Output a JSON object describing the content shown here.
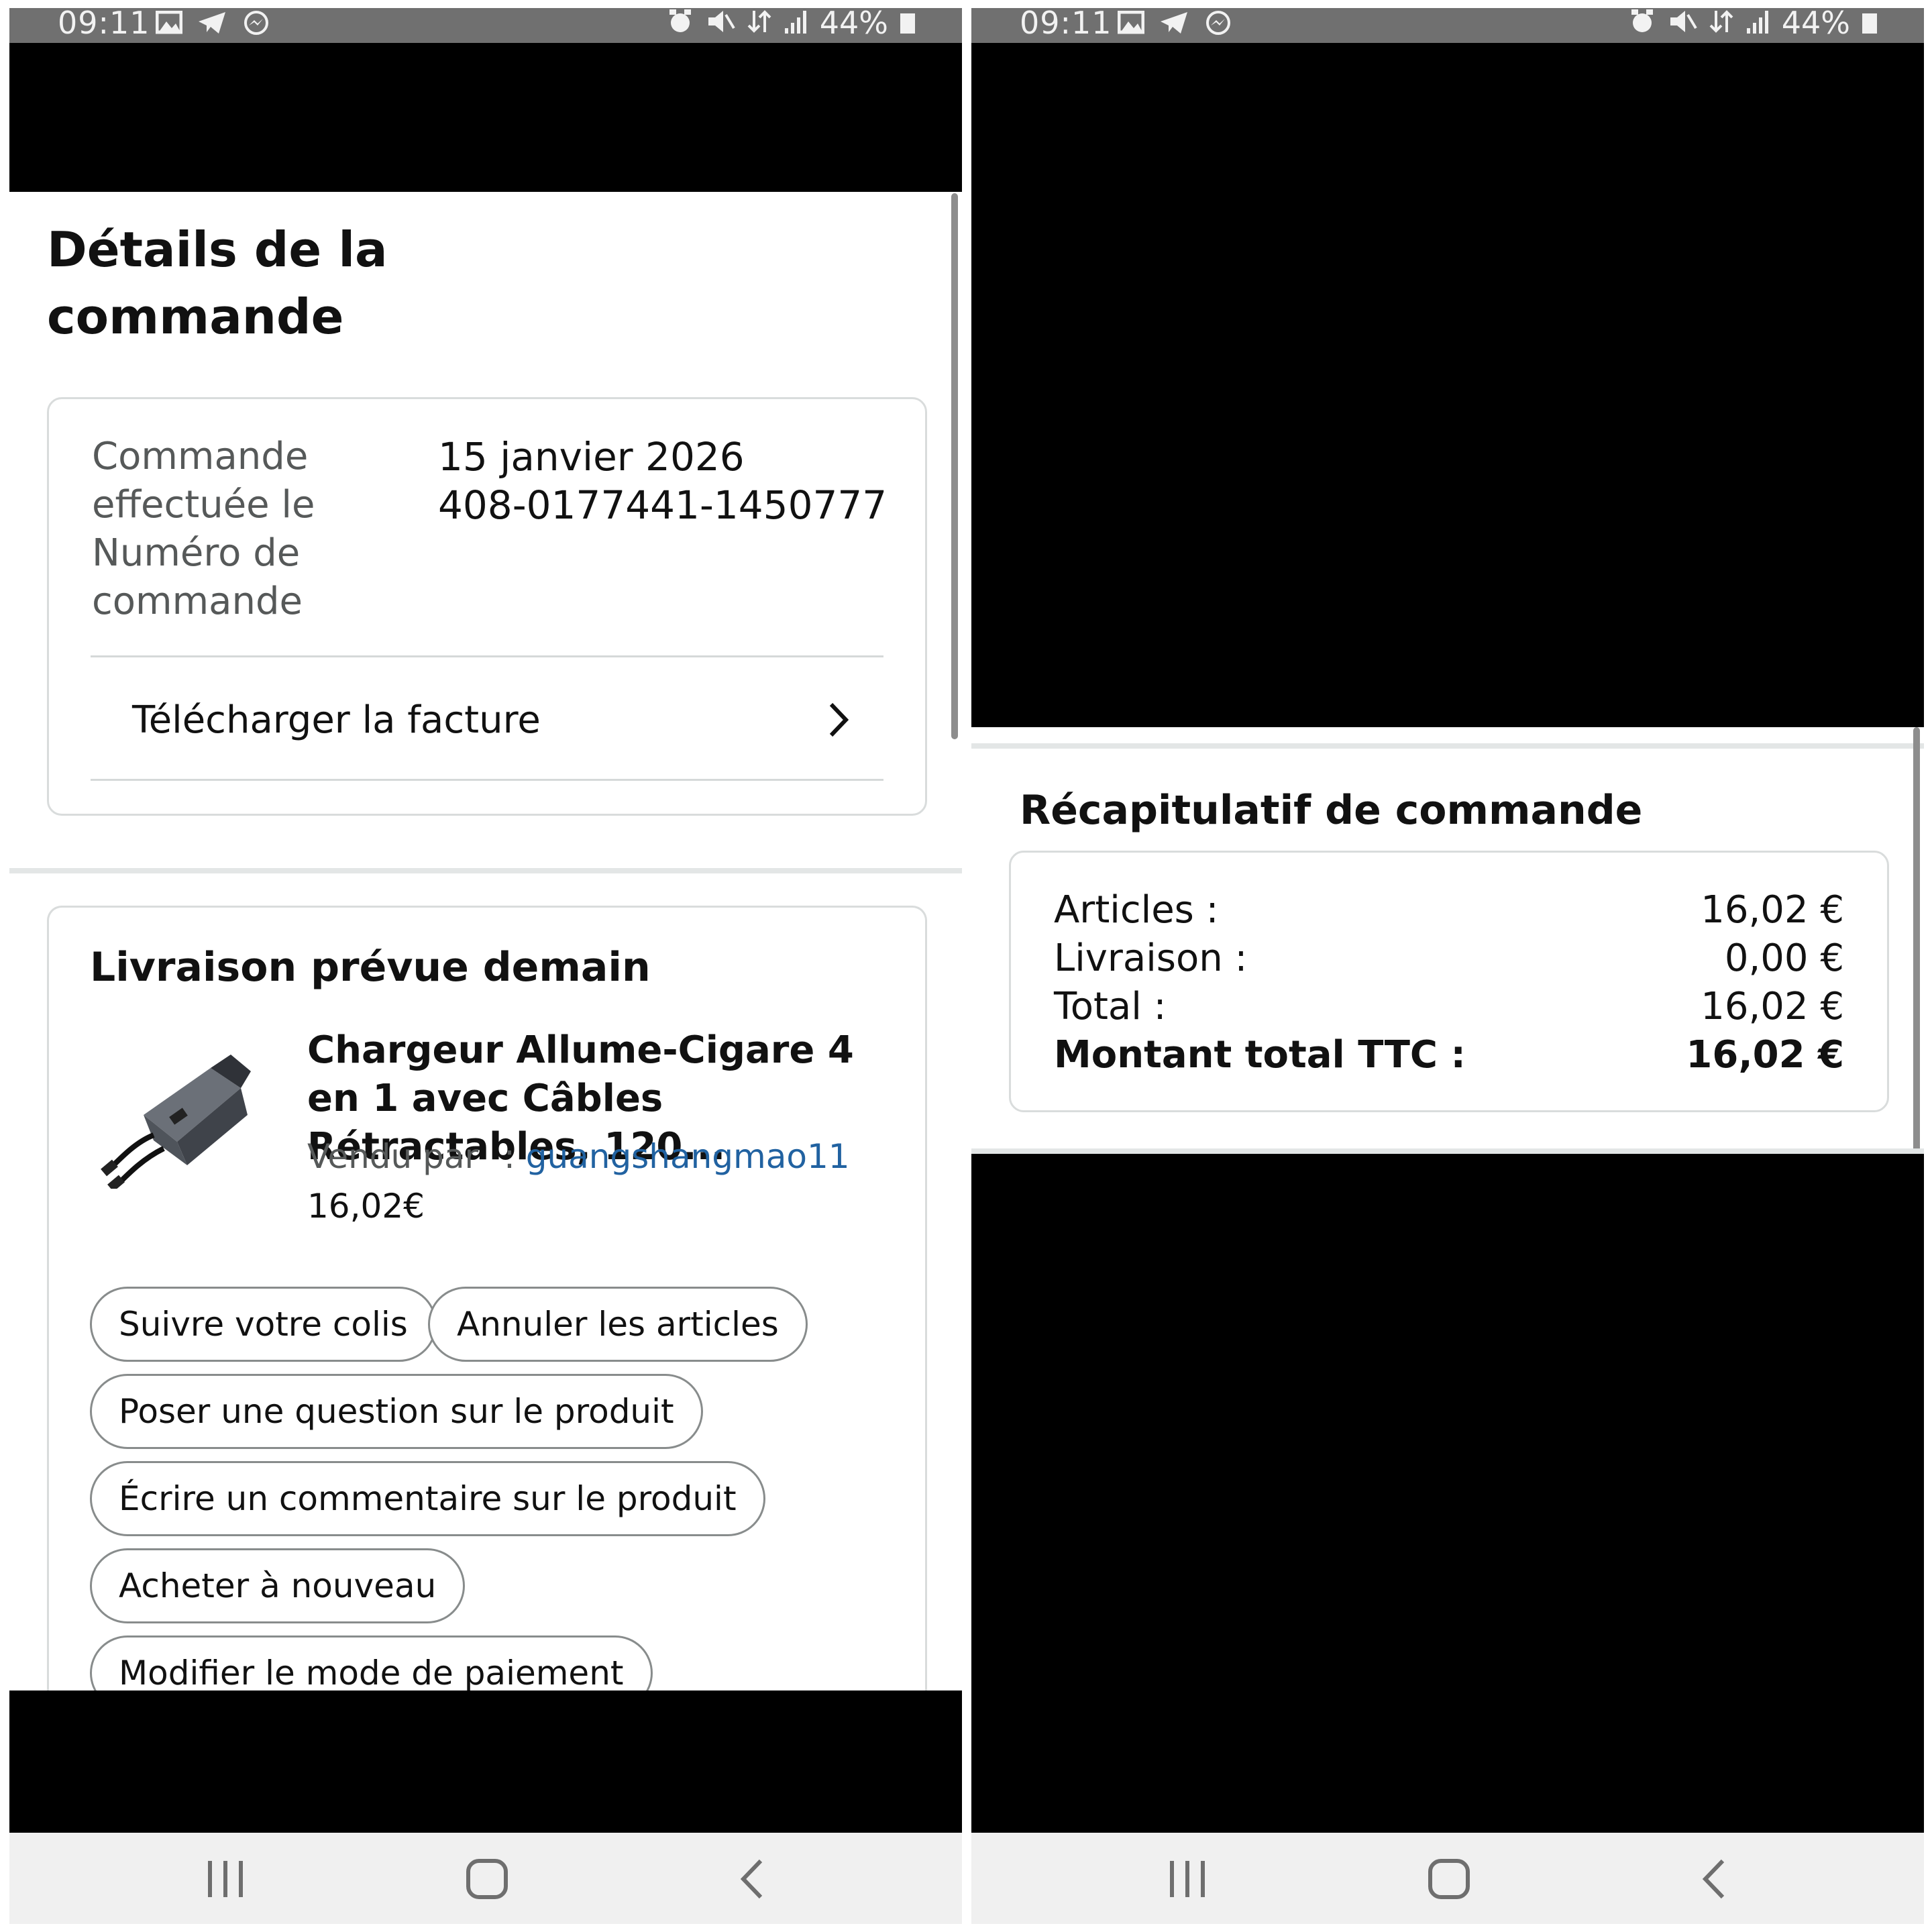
{
  "status_bar": {
    "time": "09:11",
    "battery": "44%"
  },
  "order_details": {
    "title": "Détails de la commande",
    "order_date_label": "Commande effectuée le",
    "order_date_value": "15 janvier 2026",
    "order_number_label": "Numéro de commande",
    "order_number_value": "408-0177441-1450777",
    "invoice_link": "Télécharger la facture"
  },
  "delivery": {
    "heading": "Livraison prévue demain",
    "product": {
      "title": "Chargeur Allume-Cigare 4 en 1 avec Câbles Rétractables, 120...",
      "sold_by_label": "Vendu par",
      "sold_by_sep": ":",
      "seller": "guangshangmao11",
      "price": "16,02€"
    },
    "actions": [
      "Suivre votre colis",
      "Annuler les articles",
      "Poser une question sur le produit",
      "Écrire un commentaire sur le produit",
      "Acheter à nouveau",
      "Modifier le mode de paiement"
    ]
  },
  "summary": {
    "heading": "Récapitulatif de commande",
    "rows": [
      {
        "label": "Articles :",
        "value": "16,02 €"
      },
      {
        "label": "Livraison :",
        "value": "0,00 €"
      },
      {
        "label": "Total :",
        "value": "16,02 €"
      },
      {
        "label": "Montant total TTC :",
        "value": "16,02 €"
      }
    ]
  },
  "colors": {
    "status_bar": "#707070",
    "seller_link": "#2162a1",
    "border": "#d9dcdc",
    "nav_bar": "#f0f0f0"
  },
  "icons": [
    "gallery-icon",
    "telegram-icon",
    "messenger-icon",
    "alarm-icon",
    "mute-icon",
    "data-icon",
    "signal-icon",
    "battery-icon",
    "chevron-right-icon",
    "recent-apps-icon",
    "home-icon",
    "back-icon"
  ]
}
